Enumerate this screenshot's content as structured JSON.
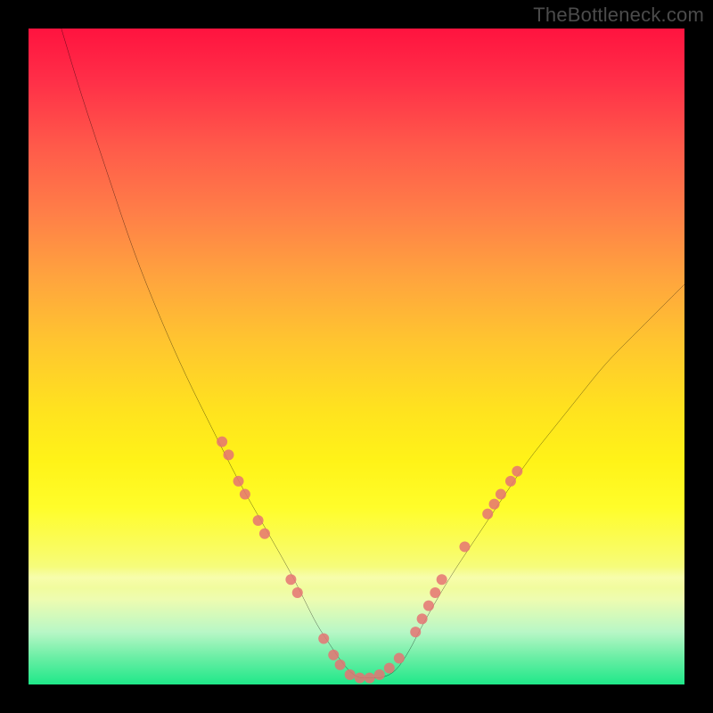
{
  "meta": {
    "watermark": "TheBottleneck.com"
  },
  "chart_data": {
    "type": "line",
    "title": "",
    "xlabel": "",
    "ylabel": "",
    "xlim": [
      0,
      100
    ],
    "ylim": [
      0,
      100
    ],
    "grid": false,
    "legend": false,
    "gradient_stops": [
      {
        "pos": 0,
        "color": "#ff133f"
      },
      {
        "pos": 8,
        "color": "#ff2f48"
      },
      {
        "pos": 18,
        "color": "#ff5a4a"
      },
      {
        "pos": 28,
        "color": "#ff7e48"
      },
      {
        "pos": 38,
        "color": "#ffa43e"
      },
      {
        "pos": 48,
        "color": "#ffc62f"
      },
      {
        "pos": 58,
        "color": "#ffe21f"
      },
      {
        "pos": 66,
        "color": "#fff318"
      },
      {
        "pos": 73,
        "color": "#fffd2a"
      },
      {
        "pos": 80,
        "color": "#f9fc66"
      },
      {
        "pos": 87,
        "color": "#eefcb0"
      },
      {
        "pos": 92,
        "color": "#b8f7c6"
      },
      {
        "pos": 96,
        "color": "#68eea4"
      },
      {
        "pos": 100,
        "color": "#1fe889"
      }
    ],
    "series": [
      {
        "name": "bottleneck-curve",
        "color": "#000000",
        "width": 2,
        "x": [
          5,
          8,
          12,
          16,
          20,
          24,
          28,
          32,
          36,
          40,
          42,
          44,
          46,
          48,
          50,
          52,
          54,
          56,
          58,
          60,
          64,
          68,
          72,
          76,
          80,
          84,
          88,
          92,
          96,
          100
        ],
        "y": [
          100,
          90,
          78,
          66,
          56,
          47,
          39,
          31,
          24,
          17,
          13,
          9,
          6,
          3,
          1,
          1,
          1,
          2,
          5,
          9,
          16,
          22,
          28,
          34,
          39,
          44,
          49,
          53,
          57,
          61
        ]
      }
    ],
    "markers": {
      "name": "highlight-dots",
      "color": "#e57373",
      "radius": 6,
      "points": [
        {
          "x": 29.5,
          "y": 37
        },
        {
          "x": 30.5,
          "y": 35
        },
        {
          "x": 32,
          "y": 31
        },
        {
          "x": 33,
          "y": 29
        },
        {
          "x": 35,
          "y": 25
        },
        {
          "x": 36,
          "y": 23
        },
        {
          "x": 40,
          "y": 16
        },
        {
          "x": 41,
          "y": 14
        },
        {
          "x": 45,
          "y": 7
        },
        {
          "x": 46.5,
          "y": 4.5
        },
        {
          "x": 47.5,
          "y": 3
        },
        {
          "x": 49,
          "y": 1.5
        },
        {
          "x": 50.5,
          "y": 1
        },
        {
          "x": 52,
          "y": 1
        },
        {
          "x": 53.5,
          "y": 1.5
        },
        {
          "x": 55,
          "y": 2.5
        },
        {
          "x": 56.5,
          "y": 4
        },
        {
          "x": 59,
          "y": 8
        },
        {
          "x": 60,
          "y": 10
        },
        {
          "x": 61,
          "y": 12
        },
        {
          "x": 62,
          "y": 14
        },
        {
          "x": 63,
          "y": 16
        },
        {
          "x": 66.5,
          "y": 21
        },
        {
          "x": 70,
          "y": 26
        },
        {
          "x": 71,
          "y": 27.5
        },
        {
          "x": 72,
          "y": 29
        },
        {
          "x": 73.5,
          "y": 31
        },
        {
          "x": 74.5,
          "y": 32.5
        }
      ]
    }
  }
}
